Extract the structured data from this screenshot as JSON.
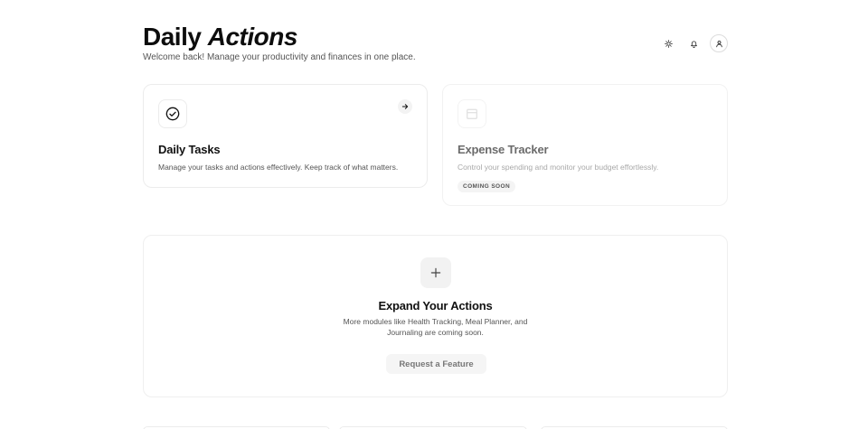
{
  "header": {
    "title_plain": "Daily",
    "title_italic": "Actions",
    "subtitle": "Welcome back! Manage your productivity and finances in one place."
  },
  "header_actions": [
    {
      "icon": "sun-icon"
    },
    {
      "icon": "bell-icon"
    },
    {
      "icon": "user-icon"
    }
  ],
  "cards": {
    "tasks": {
      "icon": "check-circle-icon",
      "title": "Daily Tasks",
      "description": "Manage your tasks and actions effectively. Keep track of what matters."
    },
    "expense": {
      "icon": "wallet-icon",
      "title": "Expense Tracker",
      "description": "Control your spending and monitor your budget effortlessly.",
      "badge": "COMING SOON"
    }
  },
  "expand": {
    "icon": "plus-icon",
    "title": "Expand Your Actions",
    "description": "More modules like Health Tracking, Meal Planner, and Journaling are coming soon.",
    "button_label": "Request a Feature"
  },
  "colors": {
    "text": "#0d0d0d",
    "muted": "#555555",
    "border": "#ececec",
    "soft_bg": "#f4f4f4"
  }
}
